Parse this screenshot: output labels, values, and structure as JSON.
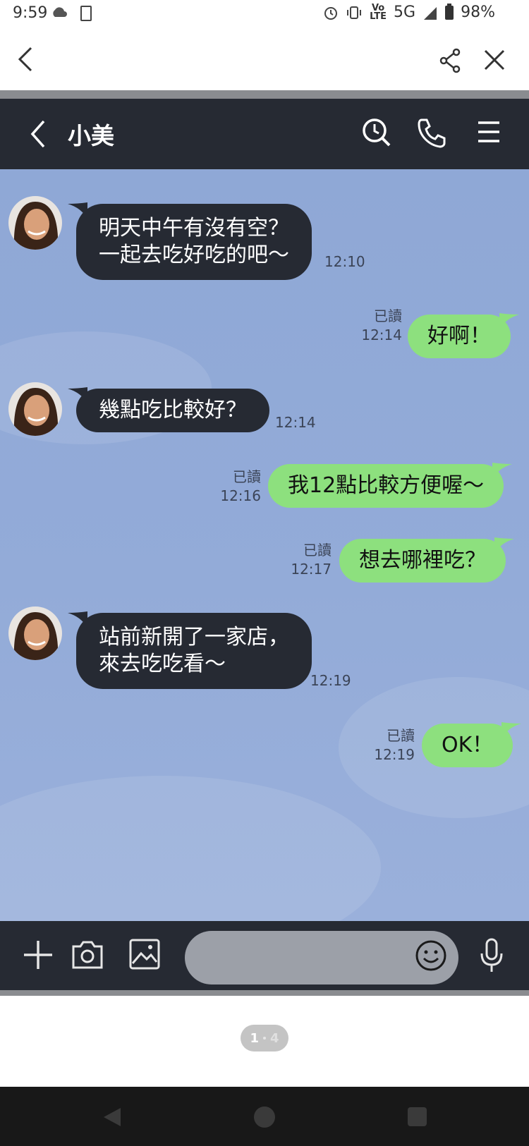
{
  "status_bar": {
    "time": "9:59",
    "network_top": "Vo",
    "network_bottom": "LTE",
    "network": "5G",
    "battery": "98%"
  },
  "chat": {
    "contact_name": "小美",
    "messages": [
      {
        "side": "in",
        "lines": [
          "明天中午有沒有空？",
          "一起去吃好吃的吧～"
        ],
        "time": "12:10"
      },
      {
        "side": "out",
        "text": "好啊！",
        "read": "已讀",
        "time": "12:14"
      },
      {
        "side": "in",
        "lines": [
          "幾點吃比較好？"
        ],
        "time": "12:14"
      },
      {
        "side": "out",
        "text": "我12點比較方便喔～",
        "read": "已讀",
        "time": "12:16"
      },
      {
        "side": "out",
        "text": "想去哪裡吃？",
        "read": "已讀",
        "time": "12:17"
      },
      {
        "side": "in",
        "lines": [
          "站前新開了一家店，",
          "來去吃吃看～"
        ],
        "time": "12:19"
      },
      {
        "side": "out",
        "text": "OK！",
        "read": "已讀",
        "time": "12:19"
      }
    ]
  },
  "input": {
    "value": "",
    "placeholder": ""
  },
  "pager": {
    "current": "1",
    "total": "4"
  },
  "colors": {
    "header_bg": "#262a33",
    "incoming_bubble": "#262a33",
    "outgoing_bubble": "#8de07e",
    "chat_background": "#93abd8"
  },
  "icons": [
    "back-icon",
    "share-icon",
    "close-icon",
    "search-icon",
    "phone-icon",
    "menu-icon",
    "plus-icon",
    "camera-icon",
    "image-icon",
    "emoji-icon",
    "mic-icon"
  ]
}
